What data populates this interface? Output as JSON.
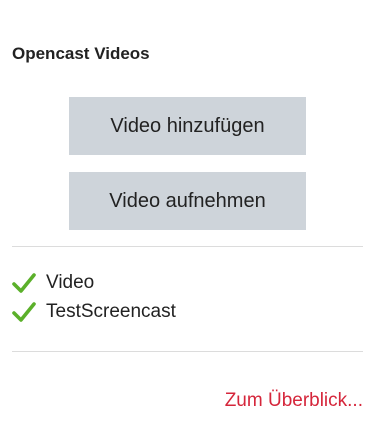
{
  "block": {
    "title": "Opencast Videos"
  },
  "buttons": {
    "add_video": "Video hinzufügen",
    "record_video": "Video aufnehmen"
  },
  "videos": [
    {
      "label": "Video",
      "status_icon": "check-icon"
    },
    {
      "label": "TestScreencast",
      "status_icon": "check-icon"
    }
  ],
  "footer": {
    "overview_link": "Zum Überblick..."
  },
  "colors": {
    "button_bg": "#ced4da",
    "check_green": "#5bb02a",
    "link_red": "#d5263b",
    "divider": "#dcdcdc"
  }
}
